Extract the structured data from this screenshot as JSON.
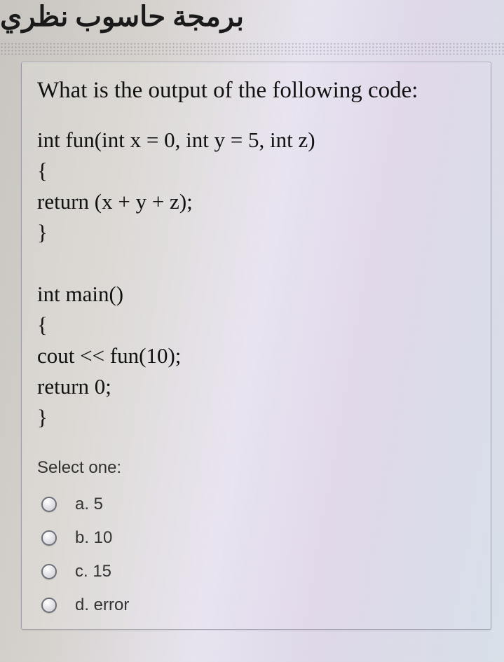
{
  "header": {
    "title_ar": "برمجة حاسوب نظري"
  },
  "question": {
    "prompt": "What is the output of the following code:",
    "code": "int fun(int x = 0, int y = 5, int z)\n{\nreturn (x + y + z);\n}\n\nint main()\n{\ncout << fun(10);\nreturn 0;\n}"
  },
  "answers": {
    "select_label": "Select one:",
    "options": [
      {
        "key": "a",
        "label": "a. 5"
      },
      {
        "key": "b",
        "label": "b. 10"
      },
      {
        "key": "c",
        "label": "c. 15"
      },
      {
        "key": "d",
        "label": "d. error"
      }
    ]
  }
}
